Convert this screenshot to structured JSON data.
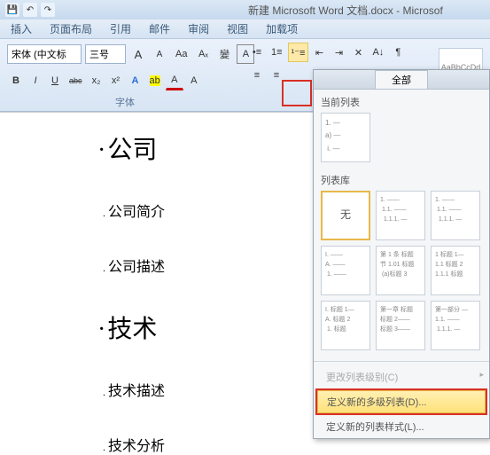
{
  "titlebar": {
    "doc_title": "新建 Microsoft Word 文档.docx - Microsof"
  },
  "tabs": {
    "insert": "插入",
    "layout": "页面布局",
    "references": "引用",
    "mailings": "邮件",
    "review": "审阅",
    "view": "视图",
    "addins": "加载项"
  },
  "font": {
    "name": "宋体 (中文标",
    "size": "三号",
    "grow": "A",
    "shrink": "A",
    "case": "Aa",
    "clear": "⌫",
    "phonetic": "變",
    "charborder": "A",
    "bold": "B",
    "italic": "I",
    "underline": "U",
    "strike": "abc",
    "sub": "x₂",
    "sup": "x²",
    "effects": "A",
    "highlight_btn": "ab",
    "color": "A",
    "group_label": "字体"
  },
  "para": {
    "bullets": "≡",
    "numbering": "≡",
    "multilevel": "≡"
  },
  "styles": {
    "quick1": "AaBbCcDd"
  },
  "dropdown": {
    "tab_all": "全部",
    "current_label": "当前列表",
    "gallery_label": "列表库",
    "none": "无",
    "change_level": "更改列表级别(C)",
    "define_new": "定义新的多级列表(D)...",
    "define_style": "定义新的列表样式(L)..."
  },
  "doc": {
    "h1_1": "公司",
    "h2_1": "公司简介",
    "h2_2": "公司描述",
    "h1_2": "技术",
    "h2_3": "技术描述",
    "h2_4": "技术分析"
  },
  "gallery_previews": {
    "current": "1. ―\na) ―\n i. ―",
    "g2": "1. ――\n 1.1. ――\n  1.1.1. ―",
    "g3": "1. ――\n 1.1. ――\n  1.1.1. ―",
    "g4": "I. ――\nA. ――\n 1. ――",
    "g5": "第 1 条 标题\n节 1.01 标题\n (a)标题 3",
    "g6": "1 标题 1―\n1.1 标题 2\n1.1.1 标题",
    "g7": "I. 标题 1―\nA. 标题 2\n 1. 标题",
    "g8": "第一章 标题\n标题 2――\n标题 3――",
    "g9": "第一部分 ―\n1.1. ――\n 1.1.1. ―"
  }
}
